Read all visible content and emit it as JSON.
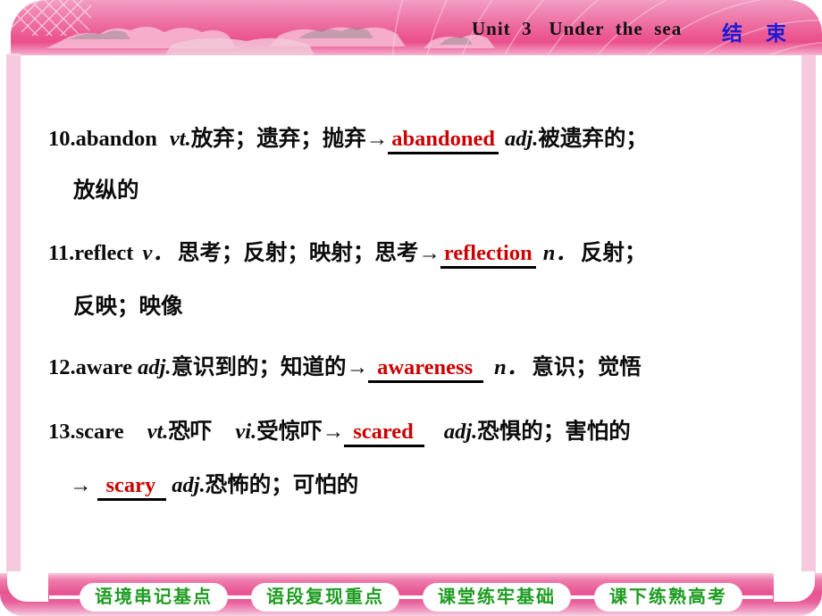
{
  "header": {
    "unit_title": "Unit  3   Under  the  sea",
    "end_label": "结 束",
    "end_color": "#1b1bd6"
  },
  "theme": {
    "banner_pink": "#ea4f8c",
    "strip_pink": "#f6c9de",
    "answer_red": "#cc0000",
    "footer_green": "#1f9c22"
  },
  "content": {
    "entries": [
      {
        "number": "10.",
        "headword": "abandon",
        "pos1": "vt.",
        "def1": "放弃；遗弃；抛弃",
        "arrow": "→",
        "answer": "abandoned",
        "pos2": "adj.",
        "def2": "被遗弃的；",
        "wrap": "放纵的"
      },
      {
        "number": "11.",
        "headword": "reflect",
        "pos1": "v．",
        "def1": "思考；反射；映射；思考",
        "arrow": "→",
        "answer": "reflection",
        "pos2": "n．",
        "def2": "反射；",
        "wrap": "反映；映像"
      },
      {
        "number": "12.",
        "headword": "aware",
        "pos1": "adj.",
        "def1": "意识到的；知道的",
        "arrow": "→",
        "answer": "awareness",
        "pos2": "n．",
        "def2": "意识；觉悟",
        "wrap": ""
      },
      {
        "number": "13.",
        "headword": "scare",
        "pos1": "vt.",
        "def1": "恐吓",
        "pos1b": "vi.",
        "def1b": "受惊吓",
        "arrow": "→",
        "answer": "scared",
        "pos2": "adj.",
        "def2": "恐惧的；害怕的",
        "arrow2": "→",
        "answer2": "scary",
        "pos3": "adj.",
        "def3": "恐怖的；可怕的"
      }
    ]
  },
  "footer": {
    "items": [
      {
        "label": "语境串记基点"
      },
      {
        "label": "语段复现重点"
      },
      {
        "label": "课堂练牢基础"
      },
      {
        "label": "课下练熟高考"
      }
    ]
  }
}
